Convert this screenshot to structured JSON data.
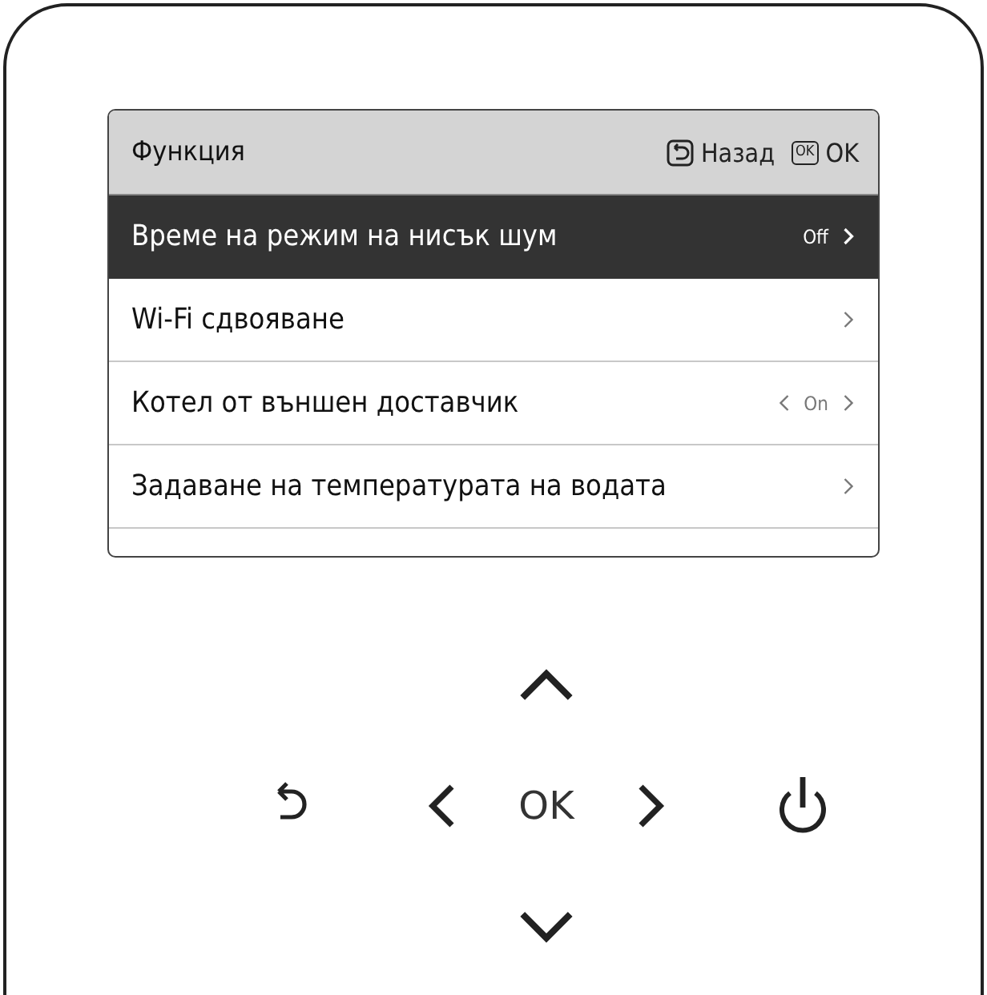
{
  "screen": {
    "title": "Функция",
    "hints": [
      {
        "kind": "back",
        "label": "Назад"
      },
      {
        "kind": "ok",
        "key": "OK",
        "label": "OK"
      }
    ],
    "items": [
      {
        "label": "Време на режим на нисък шум",
        "kind": "value",
        "value": "Off",
        "selected": true
      },
      {
        "label": "Wi-Fi сдвояване",
        "kind": "link",
        "selected": false
      },
      {
        "label": "Котел от външен доставчик",
        "kind": "toggle",
        "value": "On",
        "selected": false
      },
      {
        "label": "Задаване на температурата на водата",
        "kind": "link",
        "selected": false
      }
    ]
  },
  "keypad": {
    "ok_label": "OK"
  }
}
